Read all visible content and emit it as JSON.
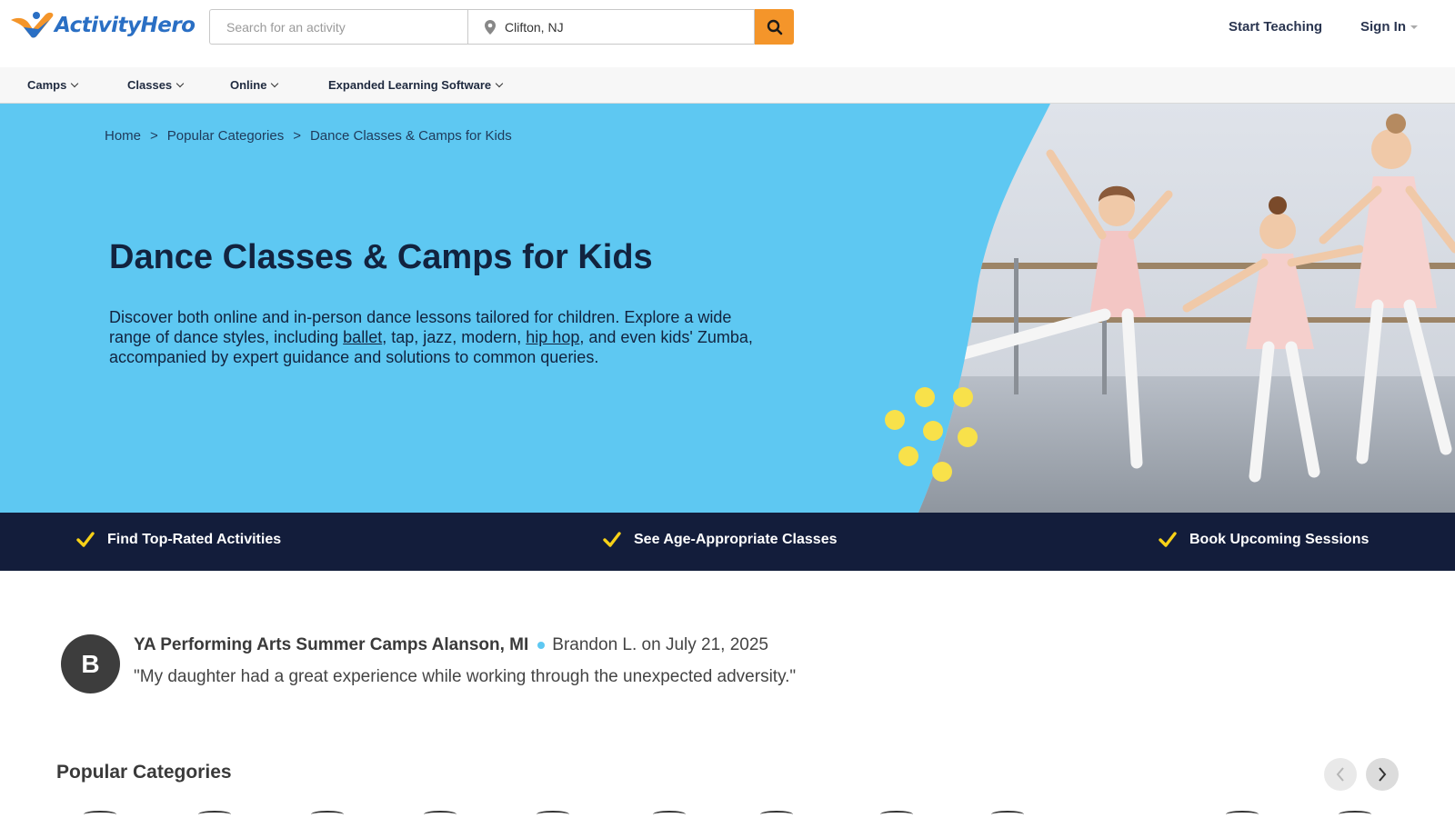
{
  "header": {
    "logo_text": "ActivityHero",
    "search_placeholder": "Search for an activity",
    "location_value": "Clifton, NJ",
    "start_teaching": "Start Teaching",
    "sign_in": "Sign In"
  },
  "nav": {
    "items": [
      {
        "label": "Camps"
      },
      {
        "label": "Classes"
      },
      {
        "label": "Online"
      },
      {
        "label": "Expanded Learning Software"
      }
    ]
  },
  "hero": {
    "breadcrumb": [
      "Home",
      "Popular Categories",
      "Dance Classes & Camps for Kids"
    ],
    "separator": ">",
    "title": "Dance Classes & Camps for Kids",
    "desc_part1": "Discover both online and in-person dance lessons tailored for children. Explore a wide range of dance styles, including ",
    "link_ballet": "ballet",
    "desc_part2": ", tap, jazz, modern, ",
    "link_hiphop": "hip hop",
    "desc_part3": ", and even kids' Zumba, accompanied by expert guidance and solutions to common queries."
  },
  "features": [
    {
      "label": "Find Top-Rated Activities"
    },
    {
      "label": "See Age-Appropriate Classes"
    },
    {
      "label": "Book Upcoming Sessions"
    }
  ],
  "review": {
    "avatar_letter": "B",
    "camp": "YA Performing Arts Summer Camps Alanson, MI",
    "author_date": "Brandon L. on July 21, 2025",
    "quote": "\"My daughter had a great experience while working through the unexpected adversity.\""
  },
  "popular": {
    "title": "Popular Categories"
  },
  "colors": {
    "hero_bg": "#5ec8f2",
    "banner_bg": "#131d3b",
    "accent_orange": "#f4952a",
    "check_yellow": "#f7d117"
  },
  "icons": [
    "logo-icon",
    "map-pin-icon",
    "search-icon",
    "chevron-down-icon",
    "check-icon",
    "chevron-left-icon",
    "chevron-right-icon"
  ]
}
